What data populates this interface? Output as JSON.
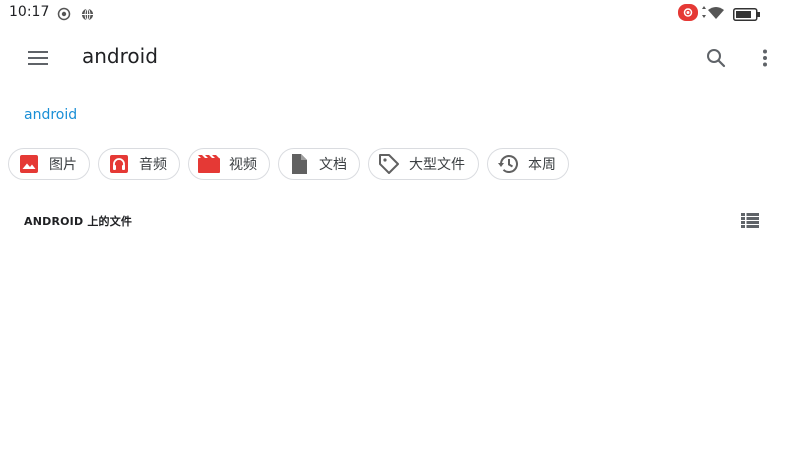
{
  "status_bar": {
    "time": "10:17",
    "icons": [
      "cast-icon",
      "globe-icon",
      "screen-record-icon",
      "wifi-icon",
      "battery-icon"
    ],
    "record_color": "#e53935"
  },
  "app_bar": {
    "title": "android",
    "menu_icon": "hamburger-menu-icon",
    "search_icon": "search-icon",
    "more_icon": "more-vert-icon"
  },
  "breadcrumb": {
    "label": "android"
  },
  "filters": [
    {
      "label": "图片",
      "icon": "image-icon",
      "color": "#e53935"
    },
    {
      "label": "音频",
      "icon": "headphones-icon",
      "color": "#e53935"
    },
    {
      "label": "视频",
      "icon": "movie-icon",
      "color": "#e53935"
    },
    {
      "label": "文档",
      "icon": "document-icon",
      "color": "#616161"
    },
    {
      "label": "大型文件",
      "icon": "tag-icon",
      "color": "#616161"
    },
    {
      "label": "本周",
      "icon": "history-icon",
      "color": "#616161"
    }
  ],
  "section": {
    "title": "ANDROID 上的文件",
    "view_icon": "list-view-icon"
  },
  "colors": {
    "accent": "#1a8fd6",
    "text": "#202124",
    "chip_border": "#dadce0"
  }
}
